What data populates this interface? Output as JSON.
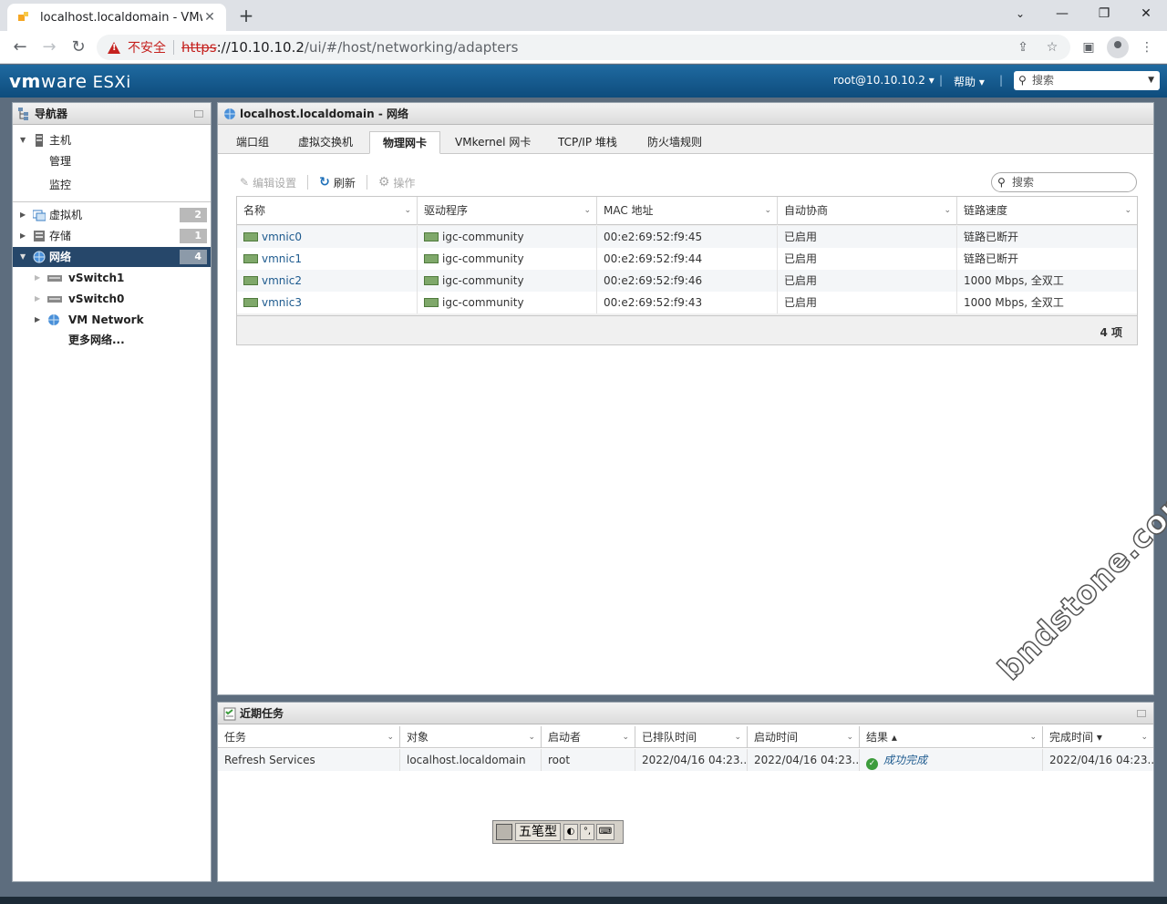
{
  "browser": {
    "tab_title": "localhost.localdomain - VMware",
    "tab_close": "✕",
    "new_tab": "+",
    "win_min": "—",
    "win_max": "❐",
    "win_close": "✕",
    "security_label": "不安全",
    "url_scheme": "https",
    "url_host": "://10.10.10.2",
    "url_path": "/ui/#/host/networking/adapters"
  },
  "header": {
    "logo_vm": "vm",
    "logo_ware": "ware",
    "logo_product": "ESXi",
    "user": "root@10.10.10.2 ▾",
    "help": "帮助 ▾",
    "search_placeholder": "搜索"
  },
  "navigator": {
    "title": "导航器",
    "host": "主机",
    "host_children": [
      "管理",
      "监控"
    ],
    "vms": {
      "label": "虚拟机",
      "count": "2"
    },
    "storage": {
      "label": "存储",
      "count": "1"
    },
    "network": {
      "label": "网络",
      "count": "4"
    },
    "network_children": [
      "vSwitch1",
      "vSwitch0",
      "VM Network"
    ],
    "more_networks": "更多网络..."
  },
  "main": {
    "title": "localhost.localdomain - 网络",
    "tabs": [
      "端口组",
      "虚拟交换机",
      "物理网卡",
      "VMkernel 网卡",
      "TCP/IP 堆栈",
      "防火墙规则"
    ],
    "active_tab": "物理网卡",
    "toolbar": {
      "edit": "编辑设置",
      "refresh": "刷新",
      "actions": "操作"
    },
    "search_placeholder": "搜索",
    "columns": [
      "名称",
      "驱动程序",
      "MAC 地址",
      "自动协商",
      "链路速度"
    ],
    "rows": [
      {
        "name": "vmnic0",
        "driver": "igc-community",
        "mac": "00:e2:69:52:f9:45",
        "auto": "已启用",
        "speed": "链路已断开"
      },
      {
        "name": "vmnic1",
        "driver": "igc-community",
        "mac": "00:e2:69:52:f9:44",
        "auto": "已启用",
        "speed": "链路已断开"
      },
      {
        "name": "vmnic2",
        "driver": "igc-community",
        "mac": "00:e2:69:52:f9:46",
        "auto": "已启用",
        "speed": "1000 Mbps, 全双工"
      },
      {
        "name": "vmnic3",
        "driver": "igc-community",
        "mac": "00:e2:69:52:f9:43",
        "auto": "已启用",
        "speed": "1000 Mbps, 全双工"
      }
    ],
    "item_count": "4 项"
  },
  "tasks": {
    "title": "近期任务",
    "columns": [
      "任务",
      "对象",
      "启动者",
      "已排队时间",
      "启动时间",
      "结果 ▴",
      "完成时间 ▾"
    ],
    "rows": [
      {
        "task": "Refresh Services",
        "target": "localhost.localdomain",
        "initiator": "root",
        "queued": "2022/04/16 04:23...",
        "started": "2022/04/16 04:23...",
        "result": "成功完成",
        "completed": "2022/04/16 04:23..."
      }
    ]
  },
  "ime": {
    "mode": "五笔型"
  },
  "watermark": "bndstone.com"
}
